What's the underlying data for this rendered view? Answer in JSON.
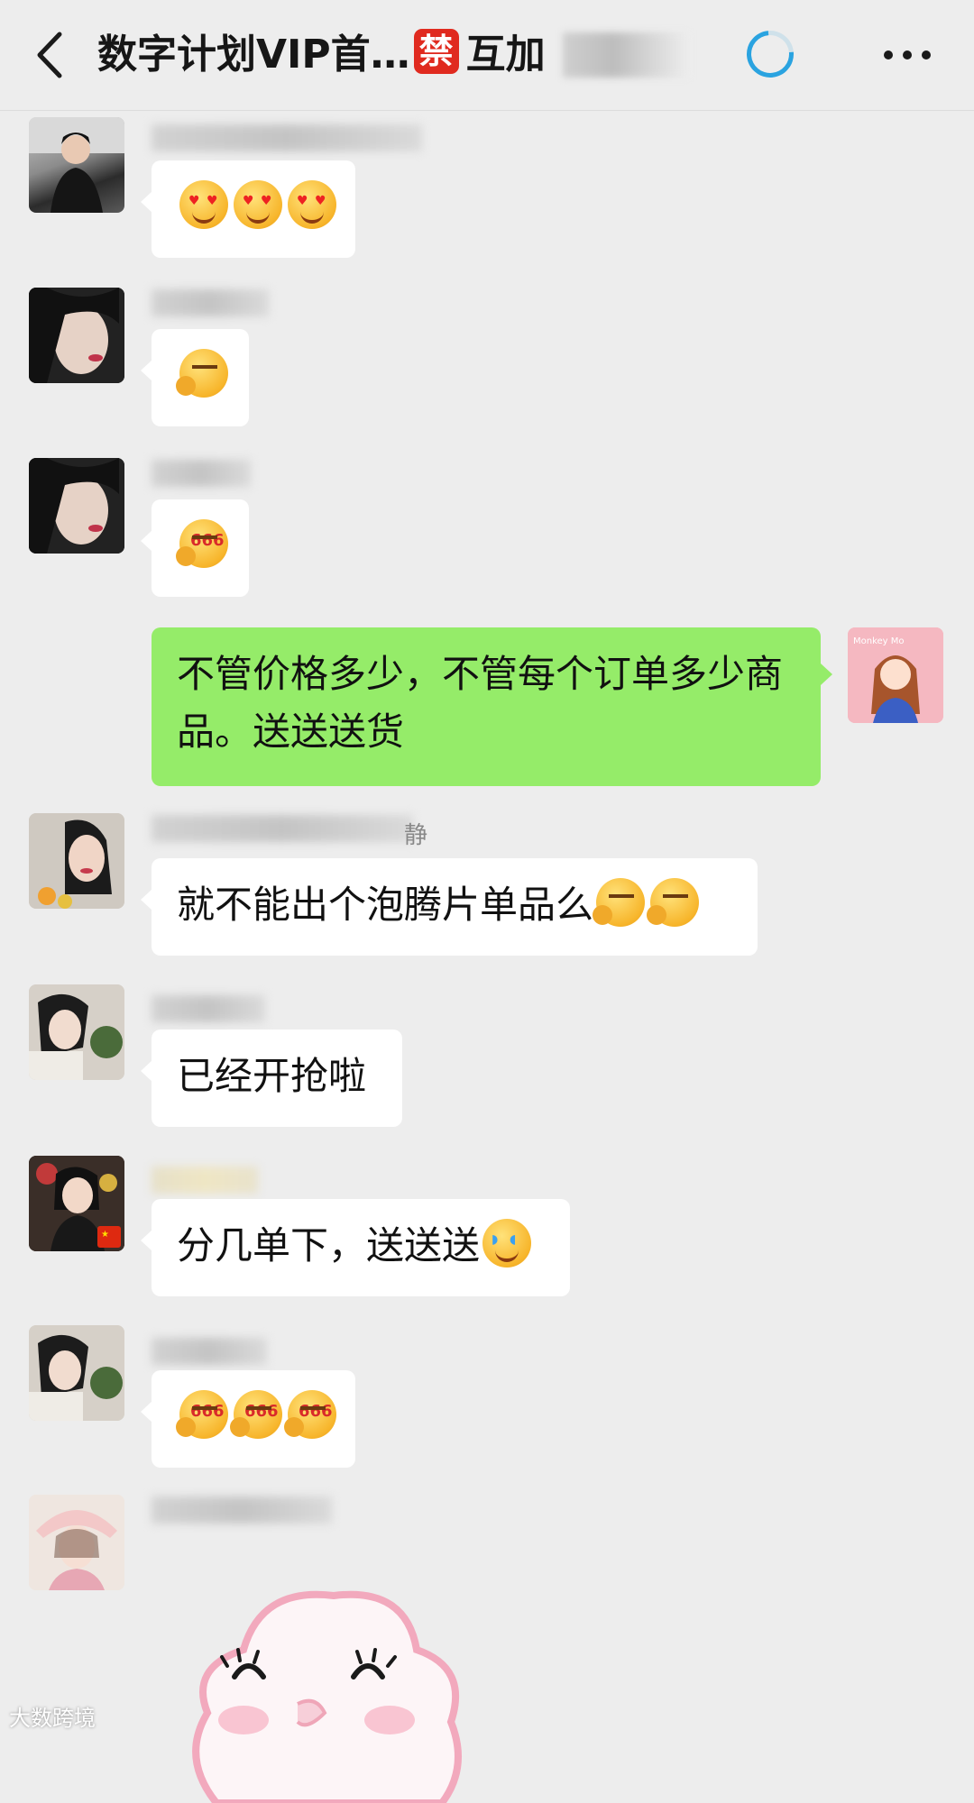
{
  "header": {
    "title": "数字计划VIP首…",
    "ban_badge": "禁",
    "title_suffix": "互加"
  },
  "messages": [
    {
      "id": "m1",
      "side": "left",
      "emojis": [
        "heart-eyes-drool-emoji",
        "heart-eyes-drool-emoji",
        "heart-eyes-drool-emoji"
      ]
    },
    {
      "id": "m2",
      "side": "left",
      "emojis": [
        "wink-emoji"
      ]
    },
    {
      "id": "m3",
      "side": "left",
      "emojis": [
        "666-emoji"
      ]
    },
    {
      "id": "m4",
      "side": "right",
      "text": "不管价格多少，不管每个订单多少商品。送送送货"
    },
    {
      "id": "m5",
      "side": "left",
      "name_fragment": "静",
      "text": "就不能出个泡腾片单品么",
      "emojis": [
        "smirk-emoji",
        "smirk-emoji"
      ]
    },
    {
      "id": "m6",
      "side": "left",
      "text": "已经开抢啦"
    },
    {
      "id": "m7",
      "side": "left",
      "text": "分几单下，送送送",
      "emojis": [
        "tears-of-joy-emoji"
      ]
    },
    {
      "id": "m8",
      "side": "left",
      "emojis": [
        "666-emoji",
        "666-emoji",
        "666-emoji"
      ]
    },
    {
      "id": "m9",
      "side": "left",
      "sticker": "pink-cloud-sticker"
    }
  ],
  "emoji_text": {
    "six": "666"
  },
  "avatar_text": {
    "right_user": "Monkey Mo"
  },
  "watermark": "大数跨境",
  "colors": {
    "background": "#ededed",
    "self_bubble": "#95ec69",
    "other_bubble": "#ffffff",
    "ban_badge": "#e02a1f",
    "loading_ring": "#2aa3e0"
  }
}
